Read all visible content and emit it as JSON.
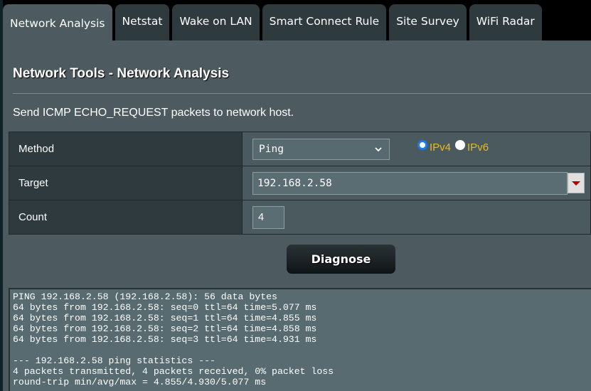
{
  "tabs": [
    {
      "label": "Network Analysis",
      "active": true
    },
    {
      "label": "Netstat",
      "active": false
    },
    {
      "label": "Wake on LAN",
      "active": false
    },
    {
      "label": "Smart Connect Rule",
      "active": false
    },
    {
      "label": "Site Survey",
      "active": false
    },
    {
      "label": "WiFi Radar",
      "active": false
    }
  ],
  "page": {
    "title": "Network Tools - Network Analysis",
    "description": "Send ICMP ECHO_REQUEST packets to network host."
  },
  "form": {
    "method": {
      "label": "Method",
      "selected": "Ping",
      "ip_versions": [
        {
          "label": "IPv4",
          "checked": true
        },
        {
          "label": "IPv6",
          "checked": false
        }
      ]
    },
    "target": {
      "label": "Target",
      "value": "192.168.2.58"
    },
    "count": {
      "label": "Count",
      "value": "4"
    }
  },
  "actions": {
    "diagnose_label": "Diagnose"
  },
  "output": {
    "lines": [
      "PING 192.168.2.58 (192.168.2.58): 56 data bytes",
      "64 bytes from 192.168.2.58: seq=0 ttl=64 time=5.077 ms",
      "64 bytes from 192.168.2.58: seq=1 ttl=64 time=4.855 ms",
      "64 bytes from 192.168.2.58: seq=2 ttl=64 time=4.858 ms",
      "64 bytes from 192.168.2.58: seq=3 ttl=64 time=4.931 ms",
      "",
      "--- 192.168.2.58 ping statistics ---",
      "4 packets transmitted, 4 packets received, 0% packet loss",
      "round-trip min/avg/max = 4.855/4.930/5.077 ms"
    ]
  },
  "colors": {
    "accent_radio": "#1a7bea",
    "radio_label": "#e8b922",
    "dropdown_arrow": "#b00000"
  }
}
